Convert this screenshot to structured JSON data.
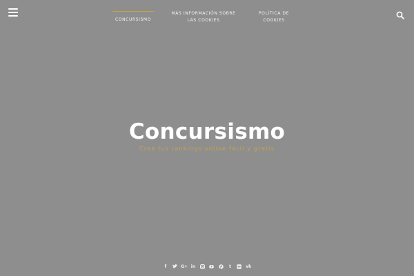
{
  "header": {
    "menu_icon": "hamburger-icon",
    "search_icon": "search-icon",
    "accent_color": "#c9a348",
    "nav": [
      {
        "label": "Concursismo",
        "active": true
      },
      {
        "label": "Más información sobre las cookies",
        "active": false
      },
      {
        "label": "Política de cookies",
        "active": false
      }
    ]
  },
  "hero": {
    "title": "Concursismo",
    "tagline": "Crea tus rankings online fácil y gratis",
    "background_color": "#8e8e8e"
  },
  "social": [
    {
      "name": "facebook-icon",
      "glyph": "f"
    },
    {
      "name": "twitter-icon",
      "glyph": ""
    },
    {
      "name": "google-plus-icon",
      "glyph": "G+"
    },
    {
      "name": "linkedin-icon",
      "glyph": "in"
    },
    {
      "name": "instagram-icon",
      "glyph": ""
    },
    {
      "name": "youtube-icon",
      "glyph": ""
    },
    {
      "name": "pinterest-icon",
      "glyph": ""
    },
    {
      "name": "tumblr-icon",
      "glyph": "t"
    },
    {
      "name": "flickr-icon",
      "glyph": ""
    },
    {
      "name": "vk-icon",
      "glyph": "vk"
    }
  ]
}
